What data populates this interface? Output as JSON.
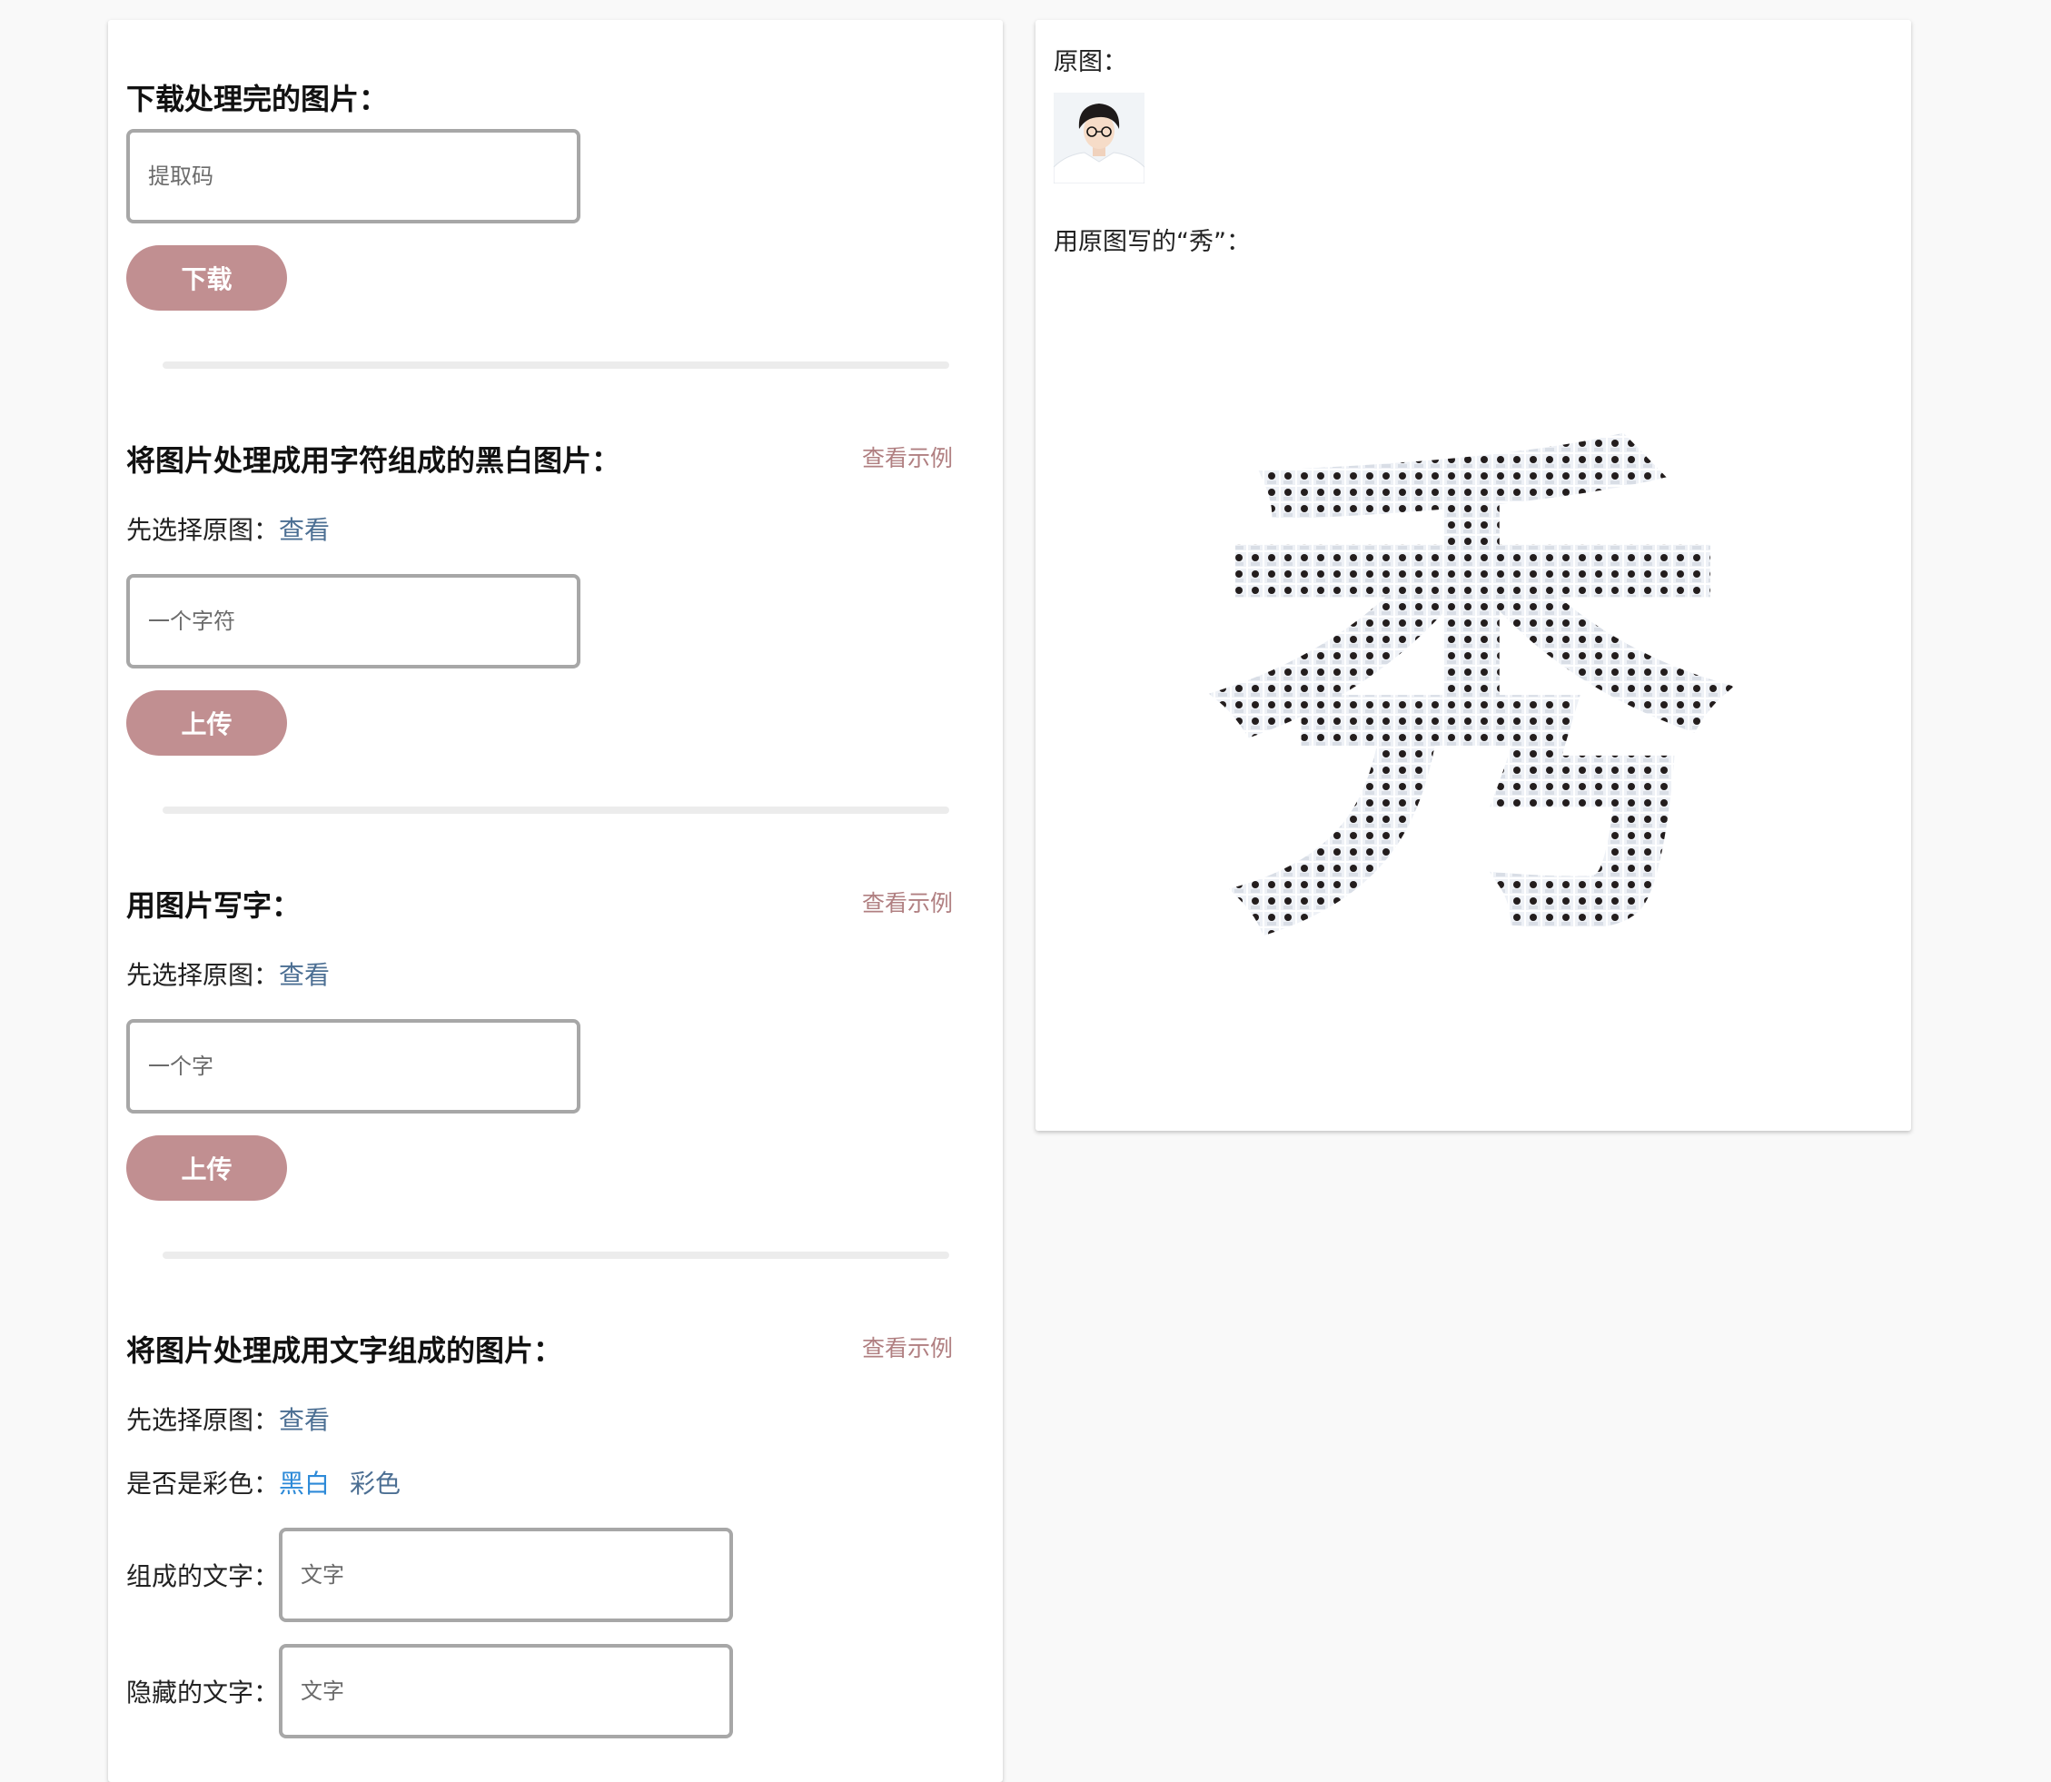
{
  "download": {
    "title": "下载处理完的图片：",
    "code_placeholder": "提取码",
    "button_label": "下载"
  },
  "ascii_section": {
    "title": "将图片处理成用字符组成的黑白图片：",
    "example_label": "查看示例",
    "choose_label": "先选择原图：",
    "view_link": "查看",
    "char_placeholder": "一个字符",
    "button_label": "上传"
  },
  "write_section": {
    "title": "用图片写字：",
    "example_label": "查看示例",
    "choose_label": "先选择原图：",
    "view_link": "查看",
    "char_placeholder": "一个字",
    "button_label": "上传"
  },
  "text_section": {
    "title": "将图片处理成用文字组成的图片：",
    "example_label": "查看示例",
    "choose_label": "先选择原图：",
    "view_link": "查看",
    "color_label": "是否是彩色：",
    "option_bw": "黑白",
    "option_color": "彩色",
    "compose_label": "组成的文字：",
    "compose_placeholder": "文字",
    "hidden_label": "隐藏的文字：",
    "hidden_placeholder": "文字"
  },
  "preview": {
    "original_label": "原图：",
    "written_label": "用原图写的“秀”：",
    "written_char": "秀"
  },
  "colors": {
    "accent_button": "#c18f91",
    "example_link": "#b07f81",
    "link": "#4c6f93",
    "active_link": "#2d8ad8"
  }
}
